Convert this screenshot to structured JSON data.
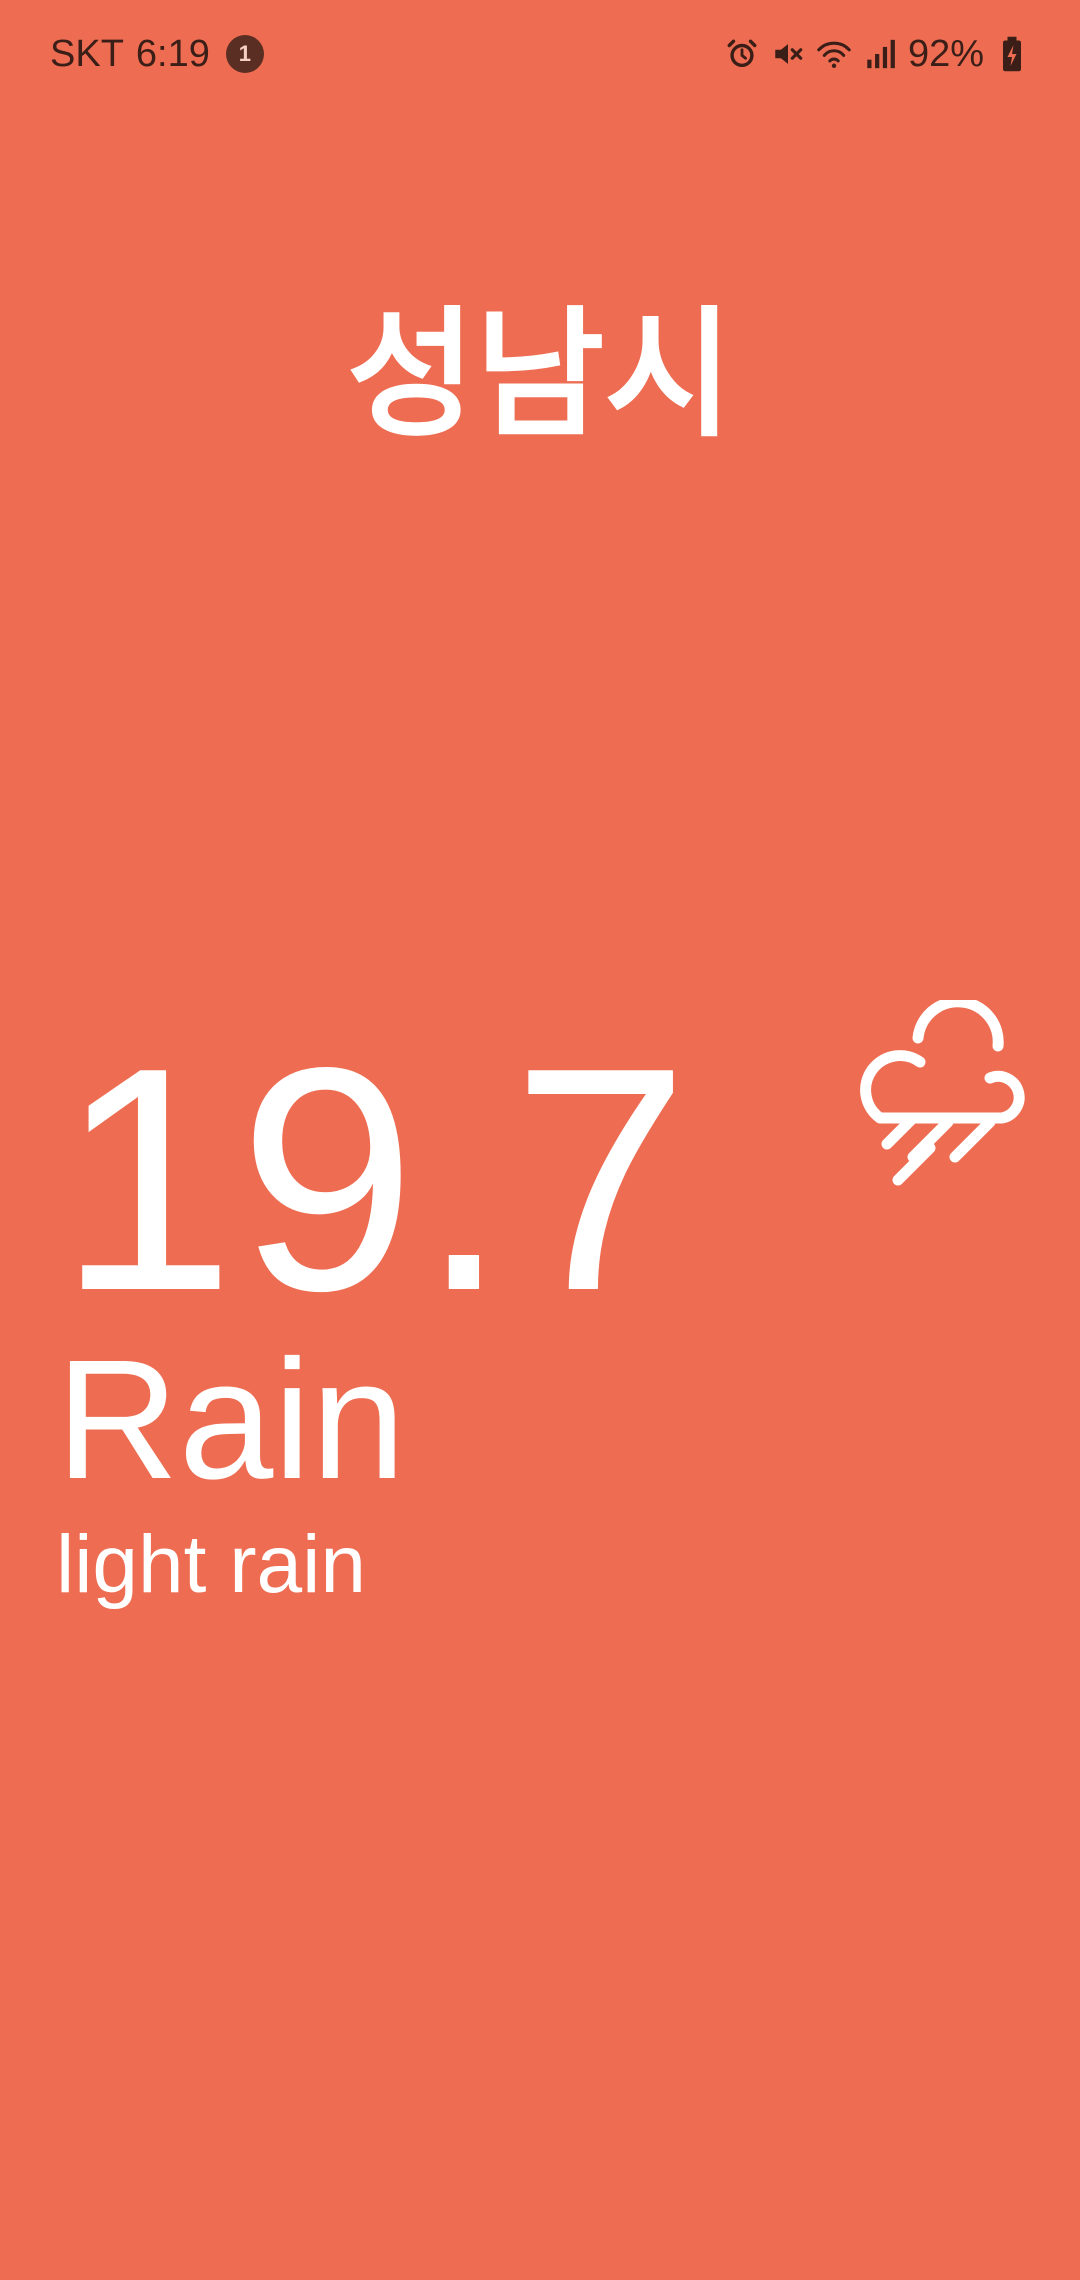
{
  "status_bar": {
    "carrier": "SKT",
    "time": "6:19",
    "notification_count": "1",
    "battery_percent": "92%",
    "icons": [
      "alarm-icon",
      "mute-icon",
      "wifi-icon",
      "signal-icon",
      "battery-charging-icon"
    ]
  },
  "weather": {
    "city": "성남시",
    "temperature": "19.7",
    "condition": "Rain",
    "description": "light rain",
    "icon": "cloud-rain-icon"
  },
  "colors": {
    "background": "#EE6D52",
    "text": "#FFFFFF",
    "status_text": "#3B1E17"
  }
}
